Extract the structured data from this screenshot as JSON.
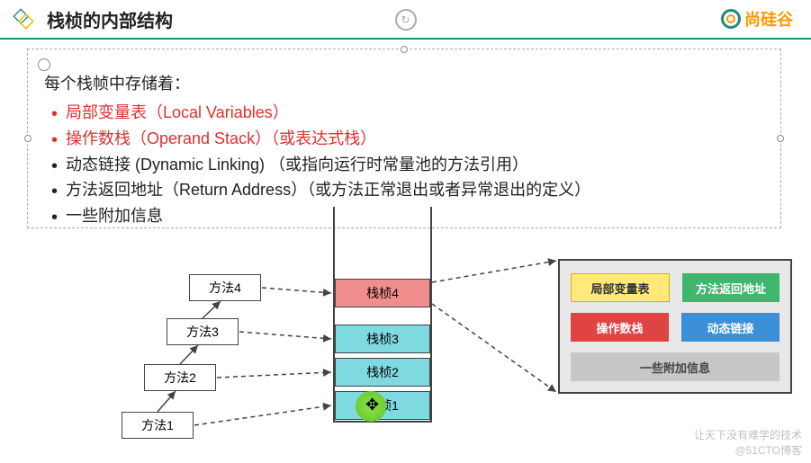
{
  "header": {
    "title": "栈桢的内部结构",
    "brand": "尚硅谷"
  },
  "intro": "每个栈帧中存储着：",
  "bullets": {
    "b0": "局部变量表（Local Variables）",
    "b1": "操作数栈（Operand Stack）（或表达式栈）",
    "b2": "动态链接 (Dynamic Linking) （或指向运行时常量池的方法引用）",
    "b3": "方法返回地址（Return Address）（或方法正常退出或者异常退出的定义）",
    "b4": "一些附加信息"
  },
  "methods": {
    "m1": "方法1",
    "m2": "方法2",
    "m3": "方法3",
    "m4": "方法4"
  },
  "frames": {
    "f1": "栈桢1",
    "f2": "栈桢2",
    "f3": "栈桢3",
    "f4": "栈桢4"
  },
  "detail": {
    "lv": "局部变量表",
    "ra": "方法返回地址",
    "os": "操作数栈",
    "dl": "动态链接",
    "extra": "一些附加信息"
  },
  "watermark": {
    "line1": "让天下没有难学的技术",
    "line2": "@51CTO博客"
  }
}
